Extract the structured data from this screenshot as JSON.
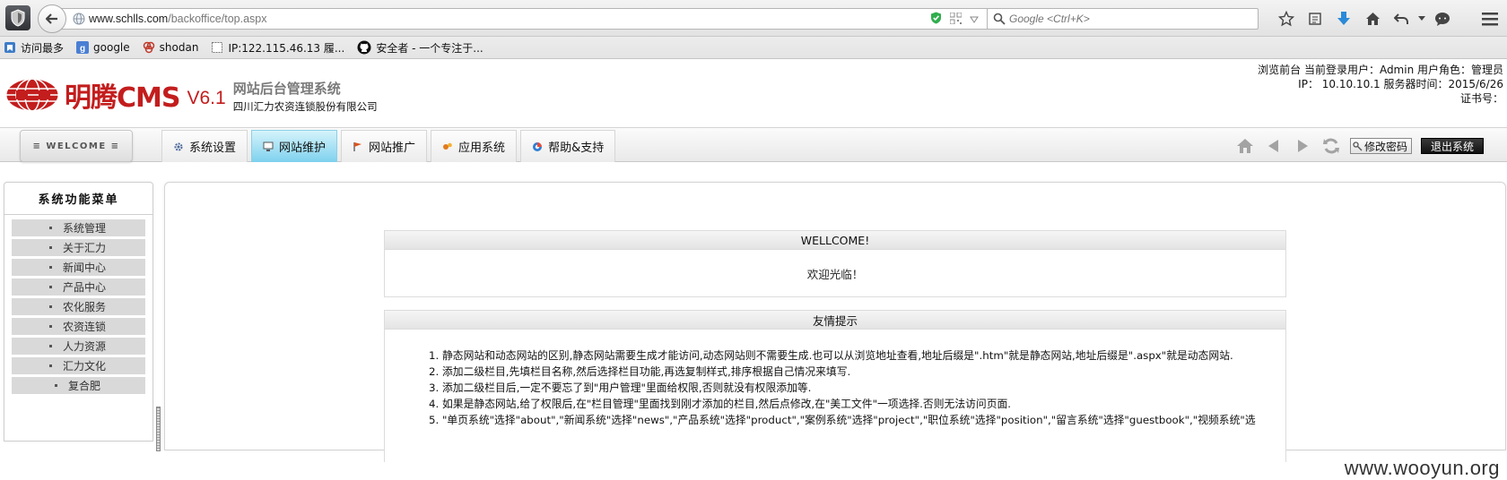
{
  "browser": {
    "url_host": "www.schlls.com",
    "url_path": "/backoffice/top.aspx",
    "search_placeholder": "Google <Ctrl+K>",
    "bookmarks": [
      {
        "label": "访问最多",
        "icon": "bookmark-folder-icon"
      },
      {
        "label": "google",
        "icon": "google-icon"
      },
      {
        "label": "shodan",
        "icon": "shodan-icon"
      },
      {
        "label": "IP:122.115.46.13 履...",
        "icon": "page-icon"
      },
      {
        "label": "安全者 - 一个专注于...",
        "icon": "github-icon"
      }
    ]
  },
  "header": {
    "logo_name": "明腾CMS",
    "logo_version": "V6.1",
    "subtitle": "网站后台管理系统",
    "company": "四川汇力农资连锁股份有限公司",
    "info_line1": "浏览前台 当前登录用户：Admin 用户角色：管理员",
    "info_line2": "IP： 10.10.10.1 服务器时间：2015/6/26",
    "info_line3": "证书号："
  },
  "nav": {
    "welcome": "≡ WELCOME ≡",
    "tabs": [
      {
        "label": "系统设置",
        "icon": "gear-icon",
        "active": false
      },
      {
        "label": "网站维护",
        "icon": "monitor-icon",
        "active": true
      },
      {
        "label": "网站推广",
        "icon": "flag-icon",
        "active": false
      },
      {
        "label": "应用系统",
        "icon": "apps-icon",
        "active": false
      },
      {
        "label": "帮助&支持",
        "icon": "help-icon",
        "active": false
      }
    ],
    "change_password": "修改密码",
    "logout": "退出系统"
  },
  "sidebar": {
    "title": "系统功能菜单",
    "items": [
      "系统管理",
      "关于汇力",
      "新闻中心",
      "产品中心",
      "农化服务",
      "农资连锁",
      "人力资源",
      "汇力文化",
      "复合肥"
    ]
  },
  "main": {
    "welcome_head": "WELLCOME!",
    "welcome_body": "欢迎光临！",
    "tips_head": "友情提示",
    "tips": [
      "1. 静态网站和动态网站的区别,静态网站需要生成才能访问,动态网站则不需要生成.也可以从浏览地址查看,地址后缀是\".htm\"就是静态网站,地址后缀是\".aspx\"就是动态网站.",
      "2. 添加二级栏目,先填栏目名称,然后选择栏目功能,再选复制样式,排序根据自己情况来填写.",
      "3. 添加二级栏目后,一定不要忘了到\"用户管理\"里面给权限,否则就没有权限添加等.",
      "4. 如果是静态网站,给了权限后,在\"栏目管理\"里面找到刚才添加的栏目,然后点修改,在\"美工文件\"一项选择.否则无法访问页面.",
      "5. \"单页系统\"选择\"about\",\"新闻系统\"选择\"news\",\"产品系统\"选择\"product\",\"案例系统\"选择\"project\",\"职位系统\"选择\"position\",\"留言系统\"选择\"guestbook\",\"视频系统\"选"
    ]
  },
  "watermark": "www.wooyun.org"
}
